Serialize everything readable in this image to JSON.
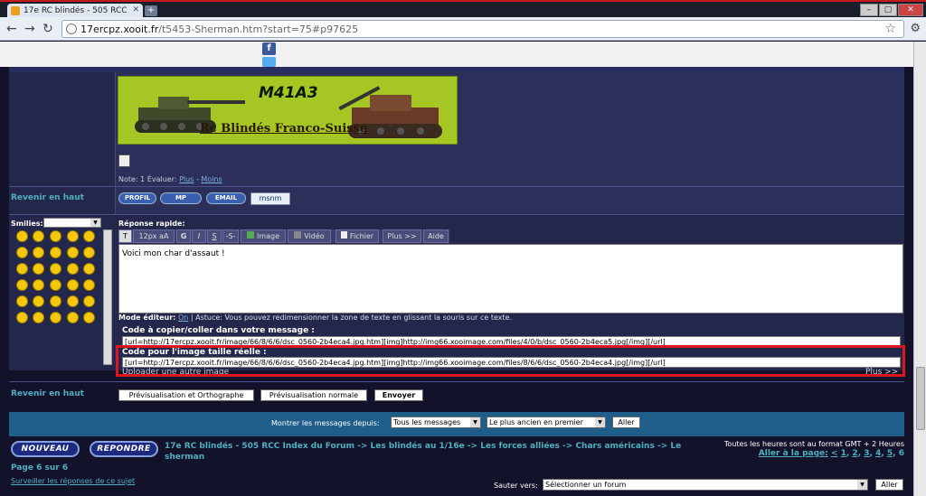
{
  "browser": {
    "tab_title": "17e RC blindés - 505 RCC",
    "new_tab": "+",
    "url_host": "17ercpz.xooit.fr",
    "url_path": "/t5453-Sherman.htm?start=75#p97625"
  },
  "post": {
    "banner_title": "M41A3",
    "banner_subtitle": "Rc Blindés Franco-Suisse",
    "note_prefix": "Note: 1  Évaluer: ",
    "note_plus": "Plus",
    "note_sep": " - ",
    "note_minus": "Moins",
    "revenir": "Revenir en haut",
    "profile_buttons": [
      "PROFIL",
      "MP",
      "EMAIL"
    ],
    "msnm": "msnm"
  },
  "reply": {
    "smilies_label": "Smilies:",
    "reponse_label": "Réponse rapide:",
    "toolbar": [
      "12px",
      "G",
      "I",
      "S",
      "-S-",
      "Image",
      "Vidéo",
      "Fichier",
      "Plus >>",
      "Aide"
    ],
    "message": "Voici mon char d'assaut !",
    "mode_editeur_label": "Mode éditeur:",
    "mode_editeur_on": "On",
    "mode_editeur_tip": " | Astuce: Vous pouvez redimensionner la zone de texte en glissant la souris sur ce texte.",
    "code_copy_label": "Code à copier/coller dans votre message :",
    "code_copy_value": "[url=http://17ercpz.xooit.fr/image/66/8/6/6/dsc_0560-2b4eca4.jpg.htm][img]http://img66.xooimage.com/files/4/0/b/dsc_0560-2b4eca5.jpg[/img][/url]",
    "code_full_label": "Code pour l'image taille réelle :",
    "code_full_value": "[url=http://17ercpz.xooit.fr/image/66/8/6/6/dsc_0560-2b4eca4.jpg.htm][img]http://img66.xooimage.com/files/8/6/6/dsc_0560-2b4eca4.jpg[/img][/url]",
    "upload_other": "Uploader une autre image",
    "plus_far": "Plus >>",
    "revenir": "Revenir en haut",
    "btn_preview_ortho": "Prévisualisation et Orthographe",
    "btn_preview": "Prévisualisation normale",
    "btn_send": "Envoyer"
  },
  "filter": {
    "label": "Montrer les messages depuis:",
    "since": "Tous les messages",
    "order": "Le plus ancien en premier",
    "go": "Aller"
  },
  "footer": {
    "btn_new": "NOUVEAU",
    "btn_reply": "REPONDRE",
    "breadcrumb": "17e RC blindés - 505 RCC Index du Forum -> Les blindés au 1/16e -> Les forces alliées -> Chars américains -> Le sherman",
    "timezone": "Toutes les heures sont au format GMT + 2 Heures",
    "goto_label": "Aller à la page:",
    "goto_pages": [
      "<",
      "1",
      "2",
      "3",
      "4",
      "5",
      "6"
    ],
    "page_of": "Page 6 sur 6",
    "watch": "Surveiller les réponses de ce sujet",
    "jump_label": "Sauter vers:",
    "jump_value": "Sélectionner un forum",
    "jump_go": "Aller"
  }
}
